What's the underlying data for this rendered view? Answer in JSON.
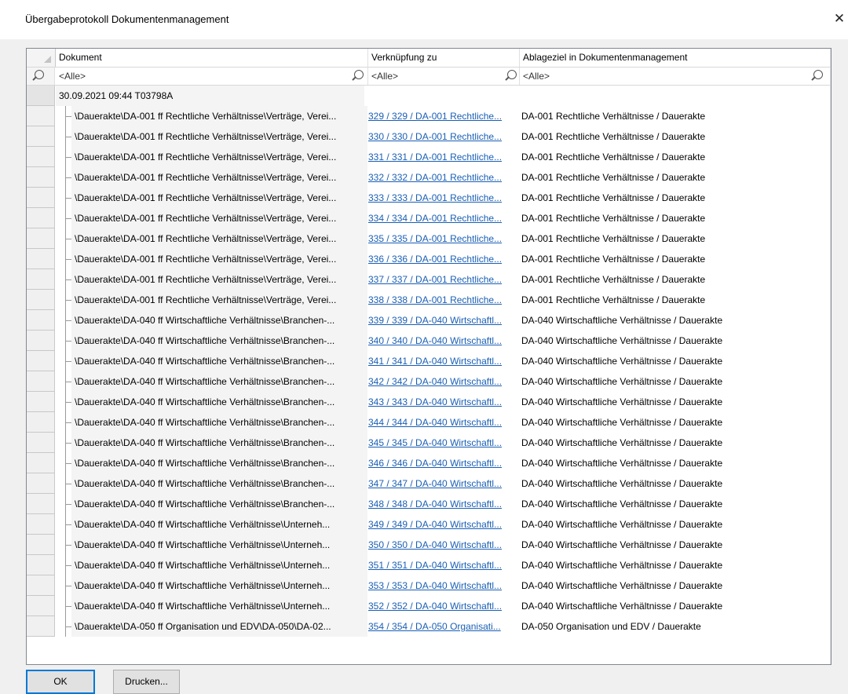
{
  "window": {
    "title": "Übergabeprotokoll Dokumentenmanagement",
    "close_glyph": "✕"
  },
  "grid": {
    "columns": [
      {
        "label": "Dokument",
        "sort": "ascending"
      },
      {
        "label": "Verknüpfung zu"
      },
      {
        "label": "Ablageziel in Dokumentenmanagement"
      }
    ],
    "filters": [
      "<Alle>",
      "<Alle>",
      "<Alle>"
    ],
    "group": "30.09.2021  09:44  T03798A",
    "rows": [
      {
        "doc": "\\Dauerakte\\DA-001 ff  Rechtliche Verhältnisse\\Verträge, Verei...",
        "link": "329 / 329 / DA-001 Rechtliche...",
        "target": "DA-001 Rechtliche Verhältnisse / Dauerakte"
      },
      {
        "doc": "\\Dauerakte\\DA-001 ff  Rechtliche Verhältnisse\\Verträge, Verei...",
        "link": "330 / 330 / DA-001 Rechtliche...",
        "target": "DA-001 Rechtliche Verhältnisse / Dauerakte"
      },
      {
        "doc": "\\Dauerakte\\DA-001 ff  Rechtliche Verhältnisse\\Verträge, Verei...",
        "link": "331 / 331 / DA-001 Rechtliche...",
        "target": "DA-001 Rechtliche Verhältnisse / Dauerakte"
      },
      {
        "doc": "\\Dauerakte\\DA-001 ff  Rechtliche Verhältnisse\\Verträge, Verei...",
        "link": "332 / 332 / DA-001 Rechtliche...",
        "target": "DA-001 Rechtliche Verhältnisse / Dauerakte"
      },
      {
        "doc": "\\Dauerakte\\DA-001 ff  Rechtliche Verhältnisse\\Verträge, Verei...",
        "link": "333 / 333 / DA-001 Rechtliche...",
        "target": "DA-001 Rechtliche Verhältnisse / Dauerakte"
      },
      {
        "doc": "\\Dauerakte\\DA-001 ff  Rechtliche Verhältnisse\\Verträge, Verei...",
        "link": "334 / 334 / DA-001 Rechtliche...",
        "target": "DA-001 Rechtliche Verhältnisse / Dauerakte"
      },
      {
        "doc": "\\Dauerakte\\DA-001 ff  Rechtliche Verhältnisse\\Verträge, Verei...",
        "link": "335 / 335 / DA-001 Rechtliche...",
        "target": "DA-001 Rechtliche Verhältnisse / Dauerakte"
      },
      {
        "doc": "\\Dauerakte\\DA-001 ff  Rechtliche Verhältnisse\\Verträge, Verei...",
        "link": "336 / 336 / DA-001 Rechtliche...",
        "target": "DA-001 Rechtliche Verhältnisse / Dauerakte"
      },
      {
        "doc": "\\Dauerakte\\DA-001 ff  Rechtliche Verhältnisse\\Verträge, Verei...",
        "link": "337 / 337 / DA-001 Rechtliche...",
        "target": "DA-001 Rechtliche Verhältnisse / Dauerakte"
      },
      {
        "doc": "\\Dauerakte\\DA-001 ff  Rechtliche Verhältnisse\\Verträge, Verei...",
        "link": "338 / 338 / DA-001 Rechtliche...",
        "target": "DA-001 Rechtliche Verhältnisse / Dauerakte"
      },
      {
        "doc": "\\Dauerakte\\DA-040 ff  Wirtschaftliche Verhältnisse\\Branchen-...",
        "link": "339 / 339 / DA-040 Wirtschaftl...",
        "target": "DA-040 Wirtschaftliche Verhältnisse / Dauerakte"
      },
      {
        "doc": "\\Dauerakte\\DA-040 ff  Wirtschaftliche Verhältnisse\\Branchen-...",
        "link": "340 / 340 / DA-040 Wirtschaftl...",
        "target": "DA-040 Wirtschaftliche Verhältnisse / Dauerakte"
      },
      {
        "doc": "\\Dauerakte\\DA-040 ff  Wirtschaftliche Verhältnisse\\Branchen-...",
        "link": "341 / 341 / DA-040 Wirtschaftl...",
        "target": "DA-040 Wirtschaftliche Verhältnisse / Dauerakte"
      },
      {
        "doc": "\\Dauerakte\\DA-040 ff  Wirtschaftliche Verhältnisse\\Branchen-...",
        "link": "342 / 342 / DA-040 Wirtschaftl...",
        "target": "DA-040 Wirtschaftliche Verhältnisse / Dauerakte"
      },
      {
        "doc": "\\Dauerakte\\DA-040 ff  Wirtschaftliche Verhältnisse\\Branchen-...",
        "link": "343 / 343 / DA-040 Wirtschaftl...",
        "target": "DA-040 Wirtschaftliche Verhältnisse / Dauerakte"
      },
      {
        "doc": "\\Dauerakte\\DA-040 ff  Wirtschaftliche Verhältnisse\\Branchen-...",
        "link": "344 / 344 / DA-040 Wirtschaftl...",
        "target": "DA-040 Wirtschaftliche Verhältnisse / Dauerakte"
      },
      {
        "doc": "\\Dauerakte\\DA-040 ff  Wirtschaftliche Verhältnisse\\Branchen-...",
        "link": "345 / 345 / DA-040 Wirtschaftl...",
        "target": "DA-040 Wirtschaftliche Verhältnisse / Dauerakte"
      },
      {
        "doc": "\\Dauerakte\\DA-040 ff  Wirtschaftliche Verhältnisse\\Branchen-...",
        "link": "346 / 346 / DA-040 Wirtschaftl...",
        "target": "DA-040 Wirtschaftliche Verhältnisse / Dauerakte"
      },
      {
        "doc": "\\Dauerakte\\DA-040 ff  Wirtschaftliche Verhältnisse\\Branchen-...",
        "link": "347 / 347 / DA-040 Wirtschaftl...",
        "target": "DA-040 Wirtschaftliche Verhältnisse / Dauerakte"
      },
      {
        "doc": "\\Dauerakte\\DA-040 ff  Wirtschaftliche Verhältnisse\\Branchen-...",
        "link": "348 / 348 / DA-040 Wirtschaftl...",
        "target": "DA-040 Wirtschaftliche Verhältnisse / Dauerakte"
      },
      {
        "doc": "\\Dauerakte\\DA-040 ff  Wirtschaftliche Verhältnisse\\Unterneh...",
        "link": "349 / 349 / DA-040 Wirtschaftl...",
        "target": "DA-040 Wirtschaftliche Verhältnisse / Dauerakte"
      },
      {
        "doc": "\\Dauerakte\\DA-040 ff  Wirtschaftliche Verhältnisse\\Unterneh...",
        "link": "350 / 350 / DA-040 Wirtschaftl...",
        "target": "DA-040 Wirtschaftliche Verhältnisse / Dauerakte"
      },
      {
        "doc": "\\Dauerakte\\DA-040 ff  Wirtschaftliche Verhältnisse\\Unterneh...",
        "link": "351 / 351 / DA-040 Wirtschaftl...",
        "target": "DA-040 Wirtschaftliche Verhältnisse / Dauerakte"
      },
      {
        "doc": "\\Dauerakte\\DA-040 ff  Wirtschaftliche Verhältnisse\\Unterneh...",
        "link": "353 / 353 / DA-040 Wirtschaftl...",
        "target": "DA-040 Wirtschaftliche Verhältnisse / Dauerakte"
      },
      {
        "doc": "\\Dauerakte\\DA-040 ff  Wirtschaftliche Verhältnisse\\Unterneh...",
        "link": "352 / 352 / DA-040 Wirtschaftl...",
        "target": "DA-040 Wirtschaftliche Verhältnisse / Dauerakte"
      },
      {
        "doc": "\\Dauerakte\\DA-050 ff  Organisation und EDV\\DA-050\\DA-02...",
        "link": "354 / 354 / DA-050 Organisati...",
        "target": "DA-050 Organisation und EDV / Dauerakte"
      }
    ]
  },
  "buttons": {
    "ok": "OK",
    "print": "Drucken..."
  }
}
